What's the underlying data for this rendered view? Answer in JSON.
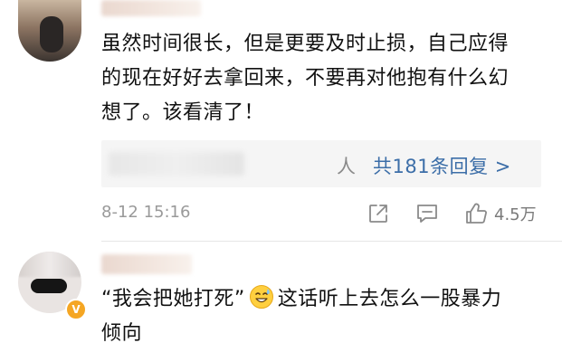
{
  "comment1": {
    "text_lines": [
      "虽然时间很长，但是更要及时止损，自己应得",
      "的现在好好去拿回来，不要再对他抱有什么幻",
      "想了。该看清了！"
    ],
    "reply_person_suffix": "等人",
    "reply_link": "共181条回复 >",
    "timestamp": "8-12 15:16",
    "like_count": "4.5万"
  },
  "comment2": {
    "quote_text": "“我会把她打死”",
    "emoji": "sweat-smile-emoji",
    "text_after_emoji": "这话听上去怎么一股暴力",
    "text_line2": "倾向",
    "badge": "V"
  },
  "icons": {
    "share": "share-icon",
    "comment": "comment-icon",
    "like": "thumbs-up-icon"
  },
  "colors": {
    "link": "#3c6ea8",
    "meta": "#9a9a9a",
    "reply_bg": "#f5f5f5",
    "badge": "#f5a623"
  }
}
